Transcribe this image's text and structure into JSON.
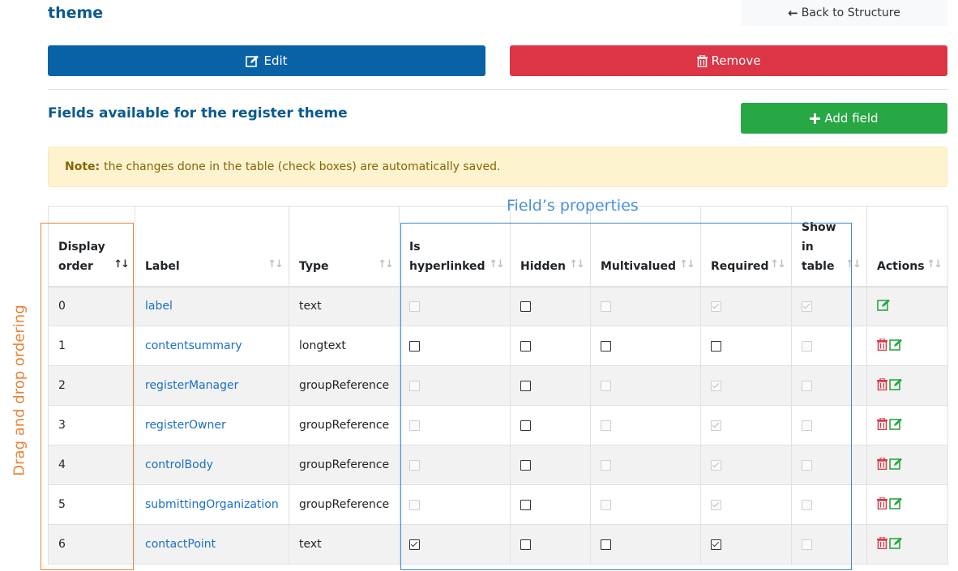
{
  "header": {
    "title": "theme",
    "back_label": "Back to Structure"
  },
  "actions": {
    "edit_label": "Edit",
    "remove_label": "Remove",
    "add_field_label": "Add field"
  },
  "section": {
    "title": "Fields available for the register theme"
  },
  "note": {
    "bold": "Note:",
    "text": "the changes done in the table (check boxes) are automatically saved."
  },
  "table": {
    "headers": {
      "display_order": [
        "Display",
        "order"
      ],
      "label": "Label",
      "type": "Type",
      "hyperlinked": [
        "Is",
        "hyperlinked"
      ],
      "hidden": "Hidden",
      "multivalued": "Multivalued",
      "required": "Required",
      "show_in_table": [
        "Show",
        "in",
        "table"
      ],
      "actions": "Actions"
    },
    "rows": [
      {
        "order": "0",
        "label": "label",
        "type": "text"
      },
      {
        "order": "1",
        "label": "contentsummary",
        "type": "longtext"
      },
      {
        "order": "2",
        "label": "registerManager",
        "type": "groupReference"
      },
      {
        "order": "3",
        "label": "registerOwner",
        "type": "groupReference"
      },
      {
        "order": "4",
        "label": "controlBody",
        "type": "groupReference"
      },
      {
        "order": "5",
        "label": "submittingOrganization",
        "type": "groupReference"
      },
      {
        "order": "6",
        "label": "contactPoint",
        "type": "text"
      }
    ]
  },
  "annotations": {
    "properties_label": "Field’s properties",
    "drag_label": "Drag and drop ordering"
  },
  "colors": {
    "edit": "#0a62a6",
    "remove": "#dc3545",
    "add": "#28a745",
    "title": "#0a5a8e",
    "annotation_orange": "#e6833a",
    "annotation_blue": "#3f86c4"
  }
}
